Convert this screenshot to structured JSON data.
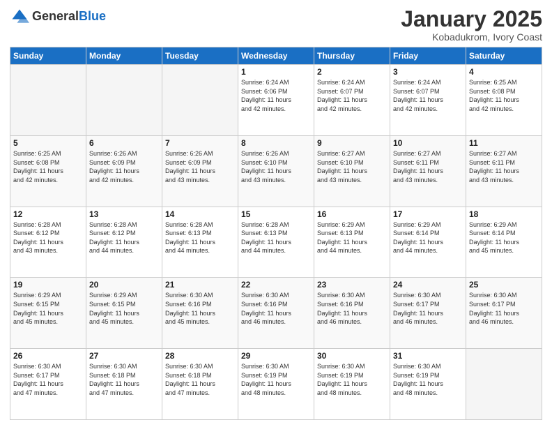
{
  "header": {
    "logo_general": "General",
    "logo_blue": "Blue",
    "title": "January 2025",
    "subtitle": "Kobadukrom, Ivory Coast"
  },
  "calendar": {
    "days_of_week": [
      "Sunday",
      "Monday",
      "Tuesday",
      "Wednesday",
      "Thursday",
      "Friday",
      "Saturday"
    ],
    "weeks": [
      [
        {
          "day": "",
          "info": ""
        },
        {
          "day": "",
          "info": ""
        },
        {
          "day": "",
          "info": ""
        },
        {
          "day": "1",
          "info": "Sunrise: 6:24 AM\nSunset: 6:06 PM\nDaylight: 11 hours\nand 42 minutes."
        },
        {
          "day": "2",
          "info": "Sunrise: 6:24 AM\nSunset: 6:07 PM\nDaylight: 11 hours\nand 42 minutes."
        },
        {
          "day": "3",
          "info": "Sunrise: 6:24 AM\nSunset: 6:07 PM\nDaylight: 11 hours\nand 42 minutes."
        },
        {
          "day": "4",
          "info": "Sunrise: 6:25 AM\nSunset: 6:08 PM\nDaylight: 11 hours\nand 42 minutes."
        }
      ],
      [
        {
          "day": "5",
          "info": "Sunrise: 6:25 AM\nSunset: 6:08 PM\nDaylight: 11 hours\nand 42 minutes."
        },
        {
          "day": "6",
          "info": "Sunrise: 6:26 AM\nSunset: 6:09 PM\nDaylight: 11 hours\nand 42 minutes."
        },
        {
          "day": "7",
          "info": "Sunrise: 6:26 AM\nSunset: 6:09 PM\nDaylight: 11 hours\nand 43 minutes."
        },
        {
          "day": "8",
          "info": "Sunrise: 6:26 AM\nSunset: 6:10 PM\nDaylight: 11 hours\nand 43 minutes."
        },
        {
          "day": "9",
          "info": "Sunrise: 6:27 AM\nSunset: 6:10 PM\nDaylight: 11 hours\nand 43 minutes."
        },
        {
          "day": "10",
          "info": "Sunrise: 6:27 AM\nSunset: 6:11 PM\nDaylight: 11 hours\nand 43 minutes."
        },
        {
          "day": "11",
          "info": "Sunrise: 6:27 AM\nSunset: 6:11 PM\nDaylight: 11 hours\nand 43 minutes."
        }
      ],
      [
        {
          "day": "12",
          "info": "Sunrise: 6:28 AM\nSunset: 6:12 PM\nDaylight: 11 hours\nand 43 minutes."
        },
        {
          "day": "13",
          "info": "Sunrise: 6:28 AM\nSunset: 6:12 PM\nDaylight: 11 hours\nand 44 minutes."
        },
        {
          "day": "14",
          "info": "Sunrise: 6:28 AM\nSunset: 6:13 PM\nDaylight: 11 hours\nand 44 minutes."
        },
        {
          "day": "15",
          "info": "Sunrise: 6:28 AM\nSunset: 6:13 PM\nDaylight: 11 hours\nand 44 minutes."
        },
        {
          "day": "16",
          "info": "Sunrise: 6:29 AM\nSunset: 6:13 PM\nDaylight: 11 hours\nand 44 minutes."
        },
        {
          "day": "17",
          "info": "Sunrise: 6:29 AM\nSunset: 6:14 PM\nDaylight: 11 hours\nand 44 minutes."
        },
        {
          "day": "18",
          "info": "Sunrise: 6:29 AM\nSunset: 6:14 PM\nDaylight: 11 hours\nand 45 minutes."
        }
      ],
      [
        {
          "day": "19",
          "info": "Sunrise: 6:29 AM\nSunset: 6:15 PM\nDaylight: 11 hours\nand 45 minutes."
        },
        {
          "day": "20",
          "info": "Sunrise: 6:29 AM\nSunset: 6:15 PM\nDaylight: 11 hours\nand 45 minutes."
        },
        {
          "day": "21",
          "info": "Sunrise: 6:30 AM\nSunset: 6:16 PM\nDaylight: 11 hours\nand 45 minutes."
        },
        {
          "day": "22",
          "info": "Sunrise: 6:30 AM\nSunset: 6:16 PM\nDaylight: 11 hours\nand 46 minutes."
        },
        {
          "day": "23",
          "info": "Sunrise: 6:30 AM\nSunset: 6:16 PM\nDaylight: 11 hours\nand 46 minutes."
        },
        {
          "day": "24",
          "info": "Sunrise: 6:30 AM\nSunset: 6:17 PM\nDaylight: 11 hours\nand 46 minutes."
        },
        {
          "day": "25",
          "info": "Sunrise: 6:30 AM\nSunset: 6:17 PM\nDaylight: 11 hours\nand 46 minutes."
        }
      ],
      [
        {
          "day": "26",
          "info": "Sunrise: 6:30 AM\nSunset: 6:17 PM\nDaylight: 11 hours\nand 47 minutes."
        },
        {
          "day": "27",
          "info": "Sunrise: 6:30 AM\nSunset: 6:18 PM\nDaylight: 11 hours\nand 47 minutes."
        },
        {
          "day": "28",
          "info": "Sunrise: 6:30 AM\nSunset: 6:18 PM\nDaylight: 11 hours\nand 47 minutes."
        },
        {
          "day": "29",
          "info": "Sunrise: 6:30 AM\nSunset: 6:19 PM\nDaylight: 11 hours\nand 48 minutes."
        },
        {
          "day": "30",
          "info": "Sunrise: 6:30 AM\nSunset: 6:19 PM\nDaylight: 11 hours\nand 48 minutes."
        },
        {
          "day": "31",
          "info": "Sunrise: 6:30 AM\nSunset: 6:19 PM\nDaylight: 11 hours\nand 48 minutes."
        },
        {
          "day": "",
          "info": ""
        }
      ]
    ]
  }
}
